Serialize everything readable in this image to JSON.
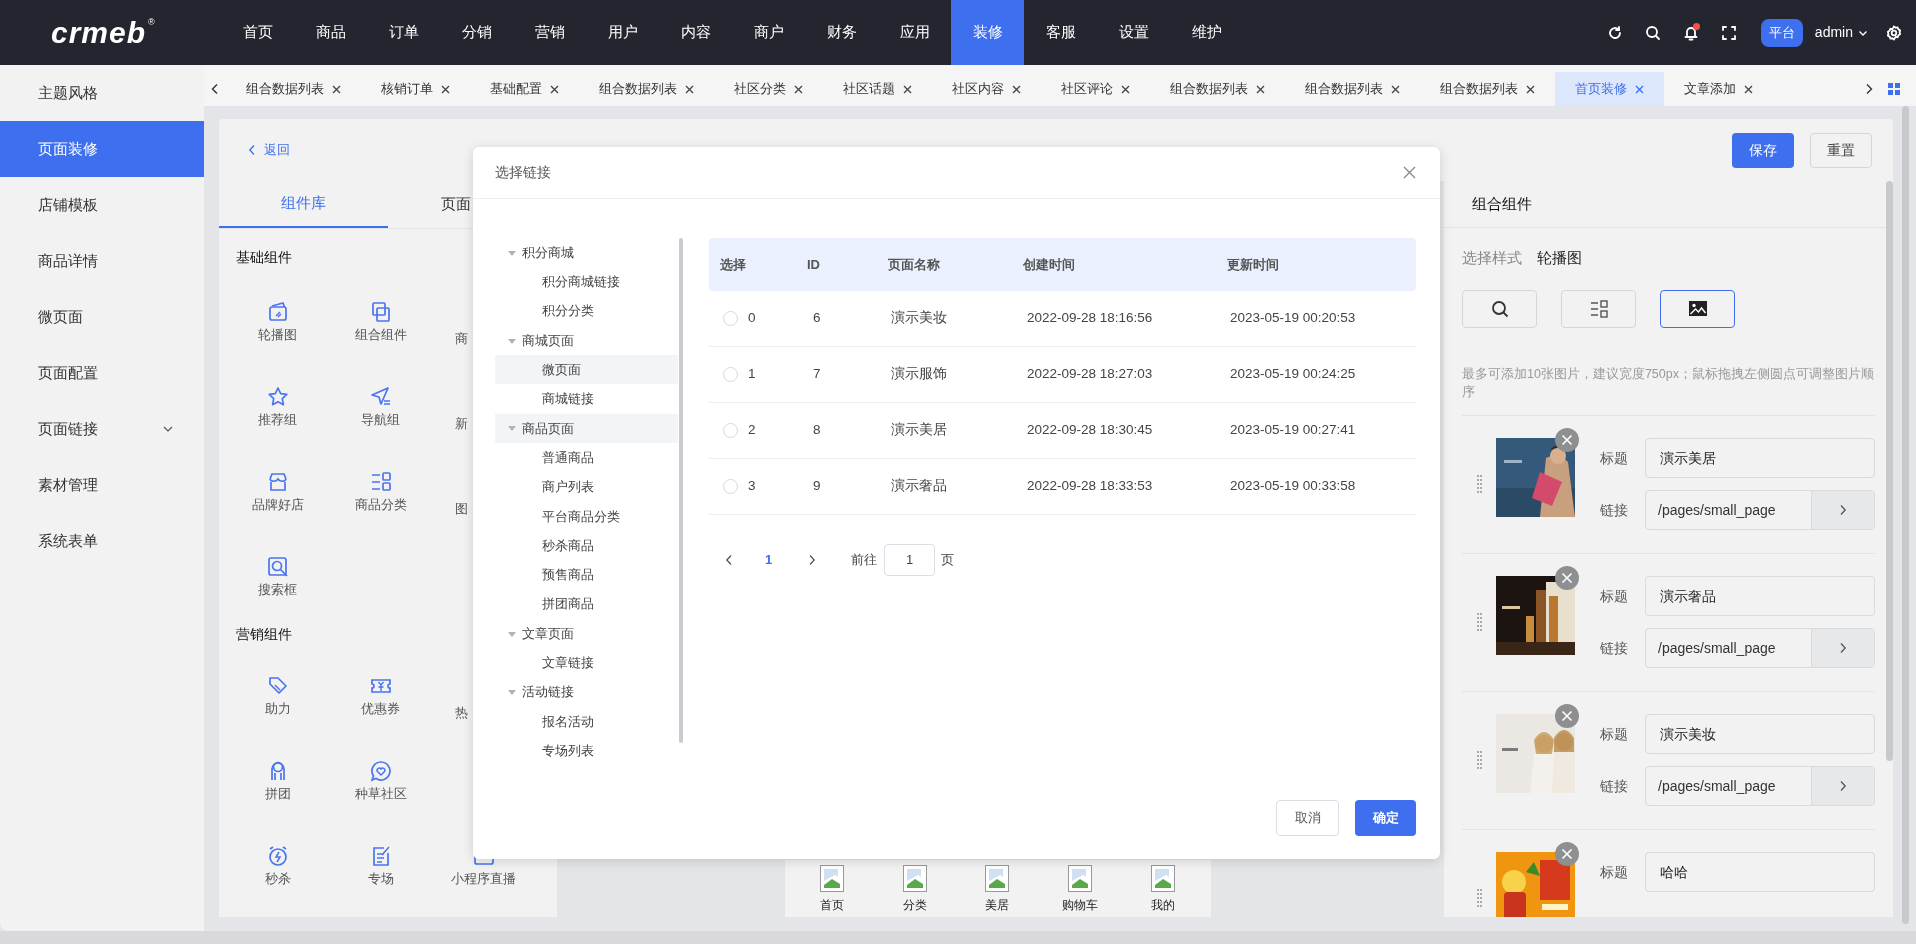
{
  "logo": {
    "text": "crmeb",
    "mark": "®"
  },
  "nav": [
    {
      "label": "首页",
      "selected": false
    },
    {
      "label": "商品",
      "selected": false
    },
    {
      "label": "订单",
      "selected": false
    },
    {
      "label": "分销",
      "selected": false
    },
    {
      "label": "营销",
      "selected": false
    },
    {
      "label": "用户",
      "selected": false
    },
    {
      "label": "内容",
      "selected": false
    },
    {
      "label": "商户",
      "selected": false
    },
    {
      "label": "财务",
      "selected": false
    },
    {
      "label": "应用",
      "selected": false
    },
    {
      "label": "装修",
      "selected": true
    },
    {
      "label": "客服",
      "selected": false
    },
    {
      "label": "设置",
      "selected": false
    },
    {
      "label": "维护",
      "selected": false
    }
  ],
  "user": {
    "platform": "平台",
    "name": "admin",
    "notification": true
  },
  "sidebar": [
    {
      "label": "主题风格",
      "selected": false,
      "expandable": false
    },
    {
      "label": "页面装修",
      "selected": true,
      "expandable": false
    },
    {
      "label": "店铺模板",
      "selected": false,
      "expandable": false
    },
    {
      "label": "商品详情",
      "selected": false,
      "expandable": false
    },
    {
      "label": "微页面",
      "selected": false,
      "expandable": false
    },
    {
      "label": "页面配置",
      "selected": false,
      "expandable": false
    },
    {
      "label": "页面链接",
      "selected": false,
      "expandable": true
    },
    {
      "label": "素材管理",
      "selected": false,
      "expandable": false
    },
    {
      "label": "系统表单",
      "selected": false,
      "expandable": false
    }
  ],
  "tabs": [
    {
      "label": "组合数据列表",
      "selected": false
    },
    {
      "label": "核销订单",
      "selected": false
    },
    {
      "label": "基础配置",
      "selected": false
    },
    {
      "label": "组合数据列表",
      "selected": false
    },
    {
      "label": "社区分类",
      "selected": false
    },
    {
      "label": "社区话题",
      "selected": false
    },
    {
      "label": "社区内容",
      "selected": false
    },
    {
      "label": "社区评论",
      "selected": false
    },
    {
      "label": "组合数据列表",
      "selected": false
    },
    {
      "label": "组合数据列表",
      "selected": false
    },
    {
      "label": "组合数据列表",
      "selected": false
    },
    {
      "label": "首页装修",
      "selected": true
    },
    {
      "label": "文章添加",
      "selected": false
    }
  ],
  "toolbar": {
    "back": "返回",
    "save": "保存",
    "reset": "重置"
  },
  "library": {
    "tabs": [
      {
        "label": "组件库",
        "selected": true
      },
      {
        "label": "页面",
        "selected": false
      }
    ],
    "groups": [
      {
        "title": "基础组件",
        "rows": [
          [
            {
              "kind": "full",
              "label": "轮播图"
            },
            {
              "kind": "full",
              "label": "组合组件"
            },
            {
              "kind": "cut",
              "label": "商"
            }
          ],
          [
            {
              "kind": "full",
              "label": "推荐组"
            },
            {
              "kind": "full",
              "label": "导航组"
            },
            {
              "kind": "cut",
              "label": "新"
            }
          ],
          [
            {
              "kind": "full",
              "label": "品牌好店"
            },
            {
              "kind": "full",
              "label": "商品分类"
            },
            {
              "kind": "cut",
              "label": "图"
            }
          ],
          [
            {
              "kind": "full",
              "label": "搜索框"
            }
          ]
        ]
      },
      {
        "title": "营销组件",
        "rows": [
          [
            {
              "kind": "full",
              "label": "助力"
            },
            {
              "kind": "full",
              "label": "优惠券"
            },
            {
              "kind": "cut",
              "label": "热"
            }
          ],
          [
            {
              "kind": "full",
              "label": "拼团"
            },
            {
              "kind": "full",
              "label": "种草社区"
            }
          ],
          [
            {
              "kind": "full",
              "label": "秒杀"
            },
            {
              "kind": "full",
              "label": "专场"
            },
            {
              "kind": "full",
              "label": "小程序直播"
            }
          ]
        ]
      }
    ]
  },
  "preview_bar": [
    "首页",
    "分类",
    "美居",
    "购物车",
    "我的"
  ],
  "modal": {
    "title": "选择链接",
    "tree": [
      {
        "label": "积分商城",
        "expanded": true,
        "highlighted": false,
        "children": [
          {
            "label": "积分商城链接",
            "highlighted": false
          },
          {
            "label": "积分分类",
            "highlighted": false
          }
        ]
      },
      {
        "label": "商城页面",
        "expanded": true,
        "highlighted": false,
        "children": [
          {
            "label": "微页面",
            "highlighted": true
          },
          {
            "label": "商城链接",
            "highlighted": false
          }
        ]
      },
      {
        "label": "商品页面",
        "expanded": true,
        "highlighted": true,
        "children": [
          {
            "label": "普通商品",
            "highlighted": false
          },
          {
            "label": "商户列表",
            "highlighted": false
          },
          {
            "label": "平台商品分类",
            "highlighted": false
          },
          {
            "label": "秒杀商品",
            "highlighted": false
          },
          {
            "label": "预售商品",
            "highlighted": false
          },
          {
            "label": "拼团商品",
            "highlighted": false
          }
        ]
      },
      {
        "label": "文章页面",
        "expanded": true,
        "highlighted": false,
        "children": [
          {
            "label": "文章链接",
            "highlighted": false
          }
        ]
      },
      {
        "label": "活动链接",
        "expanded": true,
        "highlighted": false,
        "children": [
          {
            "label": "报名活动",
            "highlighted": false
          },
          {
            "label": "专场列表",
            "highlighted": false
          }
        ]
      }
    ],
    "table": {
      "columns": [
        "选择",
        "ID",
        "页面名称",
        "创建时间",
        "更新时间"
      ],
      "rows": [
        {
          "selected": false,
          "index": "0",
          "id": "6",
          "name": "演示美妆",
          "created": "2022-09-28 18:16:56",
          "updated": "2023-05-19 00:20:53"
        },
        {
          "selected": false,
          "index": "1",
          "id": "7",
          "name": "演示服饰",
          "created": "2022-09-28 18:27:03",
          "updated": "2023-05-19 00:24:25"
        },
        {
          "selected": false,
          "index": "2",
          "id": "8",
          "name": "演示美居",
          "created": "2022-09-28 18:30:45",
          "updated": "2023-05-19 00:27:41"
        },
        {
          "selected": false,
          "index": "3",
          "id": "9",
          "name": "演示奢品",
          "created": "2022-09-28 18:33:53",
          "updated": "2023-05-19 00:33:58"
        }
      ]
    },
    "pagination": {
      "pages": [
        {
          "label": "1",
          "selected": true
        }
      ],
      "goto": "前往",
      "page_value": "1",
      "page_unit": "页"
    },
    "buttons": {
      "cancel": "取消",
      "confirm": "确定"
    }
  },
  "settings": {
    "title": "组合组件",
    "style_label": "选择样式",
    "style_name": "轮播图",
    "styles": [
      {
        "selected": false
      },
      {
        "selected": false
      },
      {
        "selected": true
      }
    ],
    "hint": "最多可添加10张图片，建议宽度750px；鼠标拖拽左侧圆点可调整图片顺序",
    "items": [
      {
        "title_label": "标题",
        "title": "演示美居",
        "link_label": "链接",
        "link": "/pages/small_page"
      },
      {
        "title_label": "标题",
        "title": "演示奢品",
        "link_label": "链接",
        "link": "/pages/small_page"
      },
      {
        "title_label": "标题",
        "title": "演示美妆",
        "link_label": "链接",
        "link": "/pages/small_page"
      },
      {
        "title_label": "标题",
        "title": "哈哈"
      }
    ]
  }
}
